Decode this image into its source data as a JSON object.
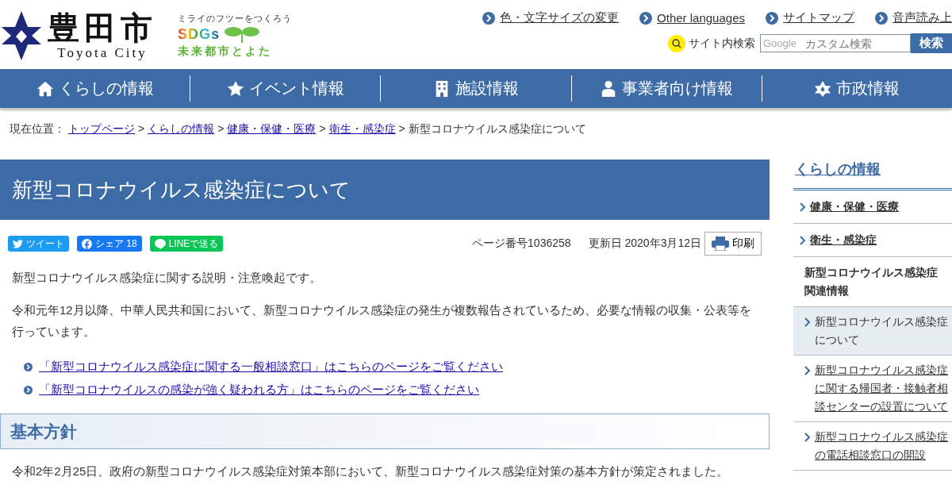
{
  "header": {
    "city_name": "豊田市",
    "city_name_en": "Toyota City",
    "slogan": "ミライのフツーをつくろう",
    "sdgs": "SDGs",
    "sdgs_sub": "未来都市とよた",
    "utility_links": [
      "色・文字サイズの変更",
      "Other languages",
      "サイトマップ",
      "音声読み上"
    ],
    "search": {
      "label": "サイト内検索",
      "brand": "Google",
      "placeholder": "カスタム検索",
      "button": "検索"
    }
  },
  "nav": [
    "くらしの情報",
    "イベント情報",
    "施設情報",
    "事業者向け情報",
    "市政情報"
  ],
  "breadcrumb": {
    "label": "現在位置：",
    "links": [
      {
        "label": "トップページ",
        "separator": ">"
      },
      {
        "label": "くらしの情報",
        "separator": ">"
      },
      {
        "label": "健康・保健・医療",
        "separator": ">"
      },
      {
        "label": "衛生・感染症",
        "separator": ">"
      }
    ],
    "current": "新型コロナウイルス感染症について"
  },
  "page_title": "新型コロナウイルス感染症について",
  "share": [
    {
      "kind": "twitter",
      "label": "ツイート"
    },
    {
      "kind": "facebook",
      "label": "シェア 18"
    },
    {
      "kind": "line",
      "label": "LINEで送る"
    }
  ],
  "page_number": "ページ番号1036258",
  "updated": "更新日 2020年3月12日",
  "print": "印刷",
  "paragraphs": [
    "新型コロナウイルス感染症に関する説明・注意喚起です。",
    "令和元年12月以降、中華人民共和国において、新型コロナウイルス感染症の発生が複数報告されているため、必要な情報の収集・公表等を行っています。"
  ],
  "links": [
    "「新型コロナウイルス感染症に関する一般相談窓口」はこちらのページをご覧ください",
    "「新型コロナウイルスの感染が強く疑われる方」はこちらのページをご覧ください"
  ],
  "section_heading": "基本方針",
  "section_text": "令和2年2月25日、政府の新型コロナウイルス感染症対策本部において、新型コロナウイルス感染症対策の基本方針が策定されました。",
  "sidebar": {
    "title": "くらしの情報",
    "items": [
      {
        "kind": "link",
        "label": "健康・保健・医療"
      },
      {
        "kind": "link",
        "label": "衛生・感染症"
      },
      {
        "kind": "heading",
        "label": "新型コロナウイルス感染症関連情報"
      },
      {
        "kind": "sub",
        "label": "新型コロナウイルス感染症について",
        "selected": true
      },
      {
        "kind": "sub",
        "label": "新型コロナウイルス感染症に関する帰国者・接触者相談センターの設置について",
        "selected": false
      },
      {
        "kind": "sub",
        "label": "新型コロナウイルス感染症の電話相談窓口の開設",
        "selected": false
      }
    ]
  }
}
